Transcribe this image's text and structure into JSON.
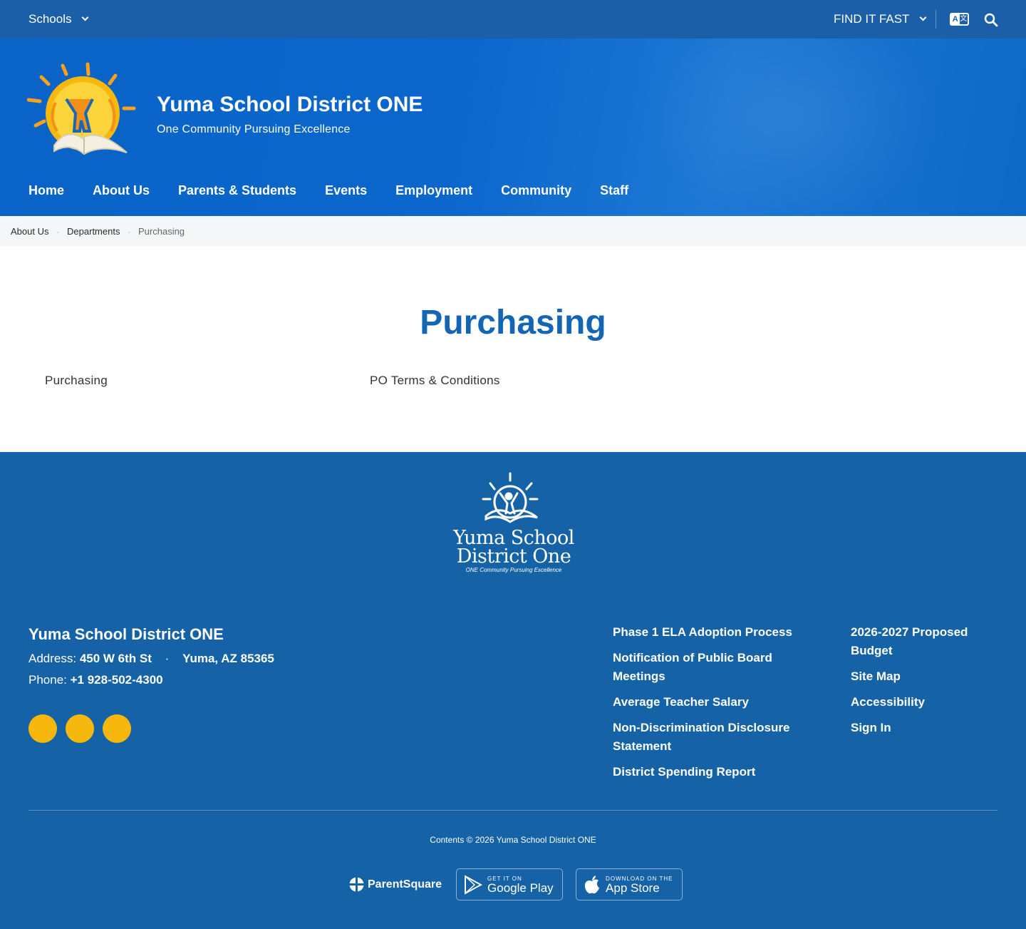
{
  "topbar": {
    "schools_label": "Schools",
    "find_it_fast_label": "FIND IT FAST"
  },
  "header": {
    "title": "Yuma School District ONE",
    "tagline": "One Community Pursuing Excellence"
  },
  "nav": {
    "items": [
      {
        "label": "Home"
      },
      {
        "label": "About Us"
      },
      {
        "label": "Parents & Students"
      },
      {
        "label": "Events"
      },
      {
        "label": "Employment"
      },
      {
        "label": "Community"
      },
      {
        "label": "Staff"
      }
    ]
  },
  "breadcrumb": {
    "items": [
      "About Us",
      "Departments"
    ],
    "current": "Purchasing"
  },
  "main": {
    "title": "Purchasing",
    "links": [
      "Purchasing",
      "PO Terms & Conditions"
    ]
  },
  "footer": {
    "logo_line1": "Yuma School",
    "logo_line2": "District One",
    "logo_tagline": "ONE Community Pursuing Excellence",
    "name": "Yuma School District ONE",
    "address_label": "Address:",
    "address_street": "450 W 6th St",
    "address_city": "Yuma, AZ 85365",
    "phone_label": "Phone:",
    "phone": "+1 928-502-4300",
    "links_col1": [
      "Phase 1 ELA Adoption Process",
      "Notification of Public Board Meetings",
      "Average Teacher Salary",
      "Non-Discrimination Disclosure Statement",
      "District Spending Report"
    ],
    "links_col2": [
      "2026-2027 Proposed Budget",
      "Site Map",
      "Accessibility",
      "Sign In"
    ],
    "copyright": "Contents © 2026 Yuma School District ONE",
    "apps": {
      "parentsquare": "ParentSquare",
      "google_small": "GET IT ON",
      "google_big": "Google Play",
      "apple_small": "DOWNLOAD ON THE",
      "apple_big": "App Store"
    }
  },
  "colors": {
    "topbar": "#1a5fa8",
    "banner": "#0b67cc",
    "title_blue": "#1565b5",
    "footer": "#1562a6",
    "social_yellow": "#f7b80e"
  }
}
